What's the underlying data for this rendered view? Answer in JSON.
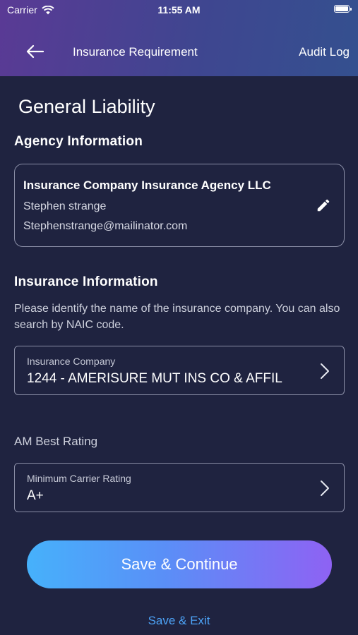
{
  "status_bar": {
    "carrier": "Carrier",
    "time": "11:55 AM"
  },
  "navbar": {
    "title": "Insurance Requirement",
    "audit_log_label": "Audit Log"
  },
  "page": {
    "title": "General Liability"
  },
  "agency": {
    "section_title": "Agency Information",
    "name": "Insurance Company Insurance Agency LLC",
    "contact_name": "Stephen strange",
    "email": "Stephenstrange@mailinator.com"
  },
  "insurance": {
    "section_title": "Insurance Information",
    "help_text": "Please identify the name of the insurance company. You can also search by NAIC code.",
    "company_field": {
      "label": "Insurance Company",
      "value": "1244 - AMERISURE MUT INS CO & AFFIL"
    }
  },
  "am_best": {
    "label": "AM Best Rating",
    "rating_field": {
      "label": "Minimum Carrier Rating",
      "value": "A+"
    }
  },
  "actions": {
    "primary_label": "Save & Continue",
    "secondary_label": "Save & Exit"
  },
  "colors": {
    "background": "#1f2340",
    "header_gradient_start": "#5a3a95",
    "header_gradient_end": "#34508f",
    "button_gradient_start": "#46b1fb",
    "button_gradient_end": "#8e62f3",
    "link": "#4da3f7",
    "border": "#8a8ea6"
  },
  "icons": [
    "wifi-icon",
    "battery-icon",
    "back-arrow-icon",
    "edit-pencil-icon",
    "chevron-right-icon"
  ]
}
